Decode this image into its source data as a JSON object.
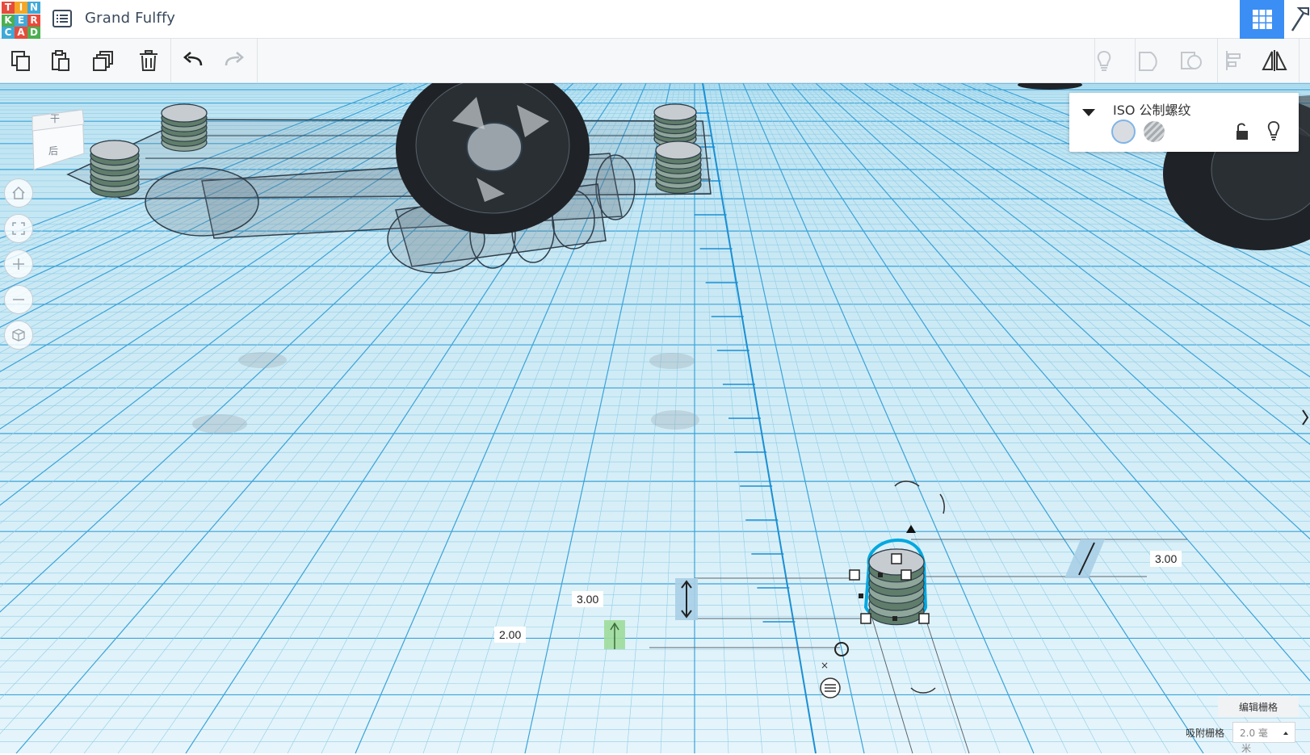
{
  "app": {
    "logo_letters": [
      "T",
      "I",
      "N",
      "K",
      "E",
      "R",
      "C",
      "A",
      "D"
    ],
    "logo_colors": [
      "#e64b3c",
      "#f5a623",
      "#3fa9d8",
      "#4caf50",
      "#3fa9d8",
      "#e64b3c",
      "#3fa9d8",
      "#e64b3c",
      "#4caf50"
    ],
    "design_title": "Grand Fulffy",
    "accent": "#3b8ef3"
  },
  "toolbar": {
    "left_tools": [
      "copy-icon",
      "paste-icon",
      "duplicate-icon",
      "delete-icon",
      "undo-icon",
      "redo-icon"
    ],
    "right_tools": [
      "lightbulb-icon",
      "group-icon",
      "ungroup-icon",
      "align-icon",
      "mirror-icon"
    ]
  },
  "viewcube": {
    "top_face": "干",
    "front_face": "后"
  },
  "shape_panel": {
    "name": "ISO 公制螺纹",
    "solid_color": "#d9dde1",
    "hole_pattern": "striped-gray"
  },
  "dimensions": {
    "height_value": "3.00",
    "elevation_value": "2.00",
    "width_value": "3.00"
  },
  "grid": {
    "edit_label": "编辑栅格",
    "snap_label": "吸附栅格",
    "snap_value": "2.0 毫",
    "snap_unit": "米"
  }
}
